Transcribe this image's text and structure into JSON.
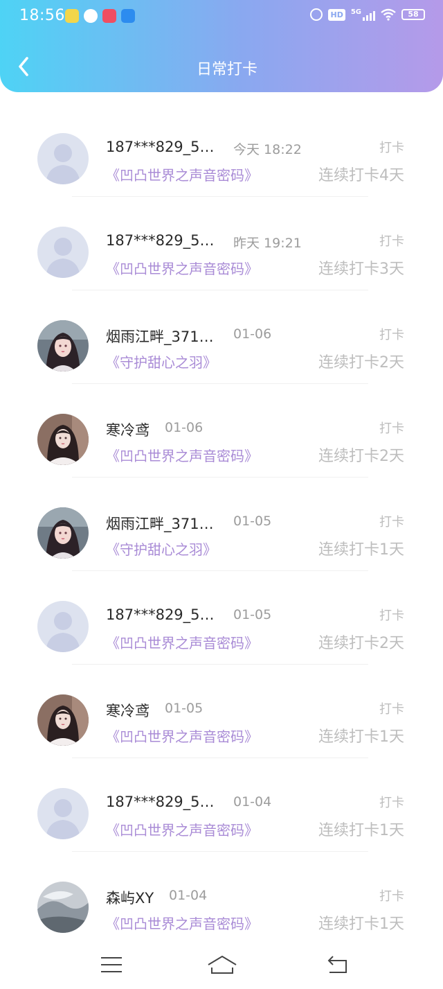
{
  "status_bar": {
    "time": "18:56",
    "hd": "HD",
    "network": "5G",
    "battery": "58"
  },
  "header": {
    "title": "日常打卡"
  },
  "records": [
    {
      "user": "187***829_5…",
      "date": "今天 18:22",
      "badge": "打卡",
      "book": "《凹凸世界之声音密码》",
      "streak": "连续打卡4天",
      "avatar": "default-avatar"
    },
    {
      "user": "187***829_5…",
      "date": "昨天 19:21",
      "badge": "打卡",
      "book": "《凹凸世界之声音密码》",
      "streak": "连续打卡3天",
      "avatar": "default-avatar"
    },
    {
      "user": "烟雨江畔_371…",
      "date": "01-06",
      "badge": "打卡",
      "book": "《守护甜心之羽》",
      "streak": "连续打卡2天",
      "avatar": "portrait-avatar-a"
    },
    {
      "user": "寒冷鸢",
      "date": "01-06",
      "badge": "打卡",
      "book": "《凹凸世界之声音密码》",
      "streak": "连续打卡2天",
      "avatar": "portrait-avatar-b"
    },
    {
      "user": "烟雨江畔_371…",
      "date": "01-05",
      "badge": "打卡",
      "book": "《守护甜心之羽》",
      "streak": "连续打卡1天",
      "avatar": "portrait-avatar-a"
    },
    {
      "user": "187***829_5…",
      "date": "01-05",
      "badge": "打卡",
      "book": "《凹凸世界之声音密码》",
      "streak": "连续打卡2天",
      "avatar": "default-avatar"
    },
    {
      "user": "寒冷鸢",
      "date": "01-05",
      "badge": "打卡",
      "book": "《凹凸世界之声音密码》",
      "streak": "连续打卡1天",
      "avatar": "portrait-avatar-b"
    },
    {
      "user": "187***829_5…",
      "date": "01-04",
      "badge": "打卡",
      "book": "《凹凸世界之声音密码》",
      "streak": "连续打卡1天",
      "avatar": "default-avatar"
    },
    {
      "user": "森屿XY",
      "date": "01-04",
      "badge": "打卡",
      "book": "《凹凸世界之声音密码》",
      "streak": "连续打卡1天",
      "avatar": "landscape-avatar"
    }
  ],
  "colors": {
    "header_gradient_start": "#4ed3f5",
    "header_gradient_end": "#b59ae9",
    "book_title": "#a98bd6",
    "muted_text": "#bdbdbd"
  },
  "nav": {
    "icons": [
      "menu-icon",
      "home-icon",
      "back-icon"
    ]
  }
}
